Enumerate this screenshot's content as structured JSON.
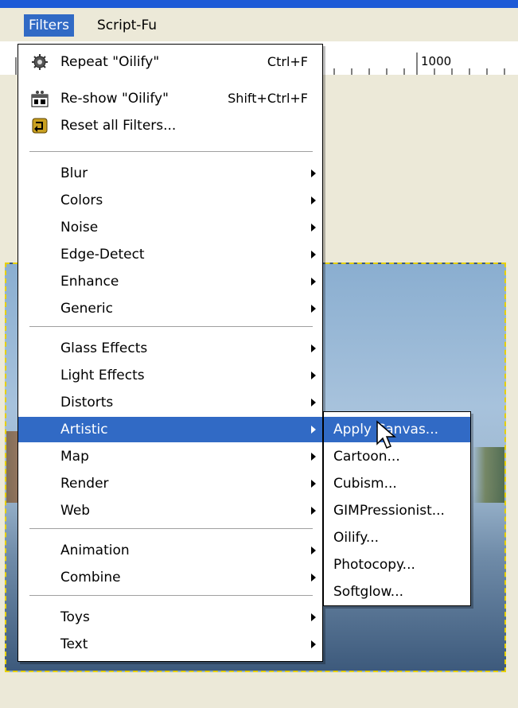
{
  "menubar": {
    "filters": "Filters",
    "script_fu": "Script-Fu"
  },
  "ruler": {
    "label": "1000"
  },
  "menu": {
    "repeat": {
      "label": "Repeat \"Oilify\"",
      "shortcut": "Ctrl+F"
    },
    "reshow": {
      "label": "Re-show \"Oilify\"",
      "shortcut": "Shift+Ctrl+F"
    },
    "reset": {
      "label": "Reset all Filters..."
    },
    "items": [
      "Blur",
      "Colors",
      "Noise",
      "Edge-Detect",
      "Enhance",
      "Generic",
      "Glass Effects",
      "Light Effects",
      "Distorts",
      "Artistic",
      "Map",
      "Render",
      "Web",
      "Animation",
      "Combine",
      "Toys",
      "Text"
    ]
  },
  "submenu": {
    "items": [
      "Apply Canvas...",
      "Cartoon...",
      "Cubism...",
      "GIMPressionist...",
      "Oilify...",
      "Photocopy...",
      "Softglow..."
    ]
  },
  "colors": {
    "highlight": "#316ac5",
    "selection_border": "#e6d000"
  },
  "icons": {
    "repeat": "gear-icon",
    "reshow": "dialog-icon",
    "reset": "reset-icon",
    "cursor": "mouse-pointer-icon"
  }
}
